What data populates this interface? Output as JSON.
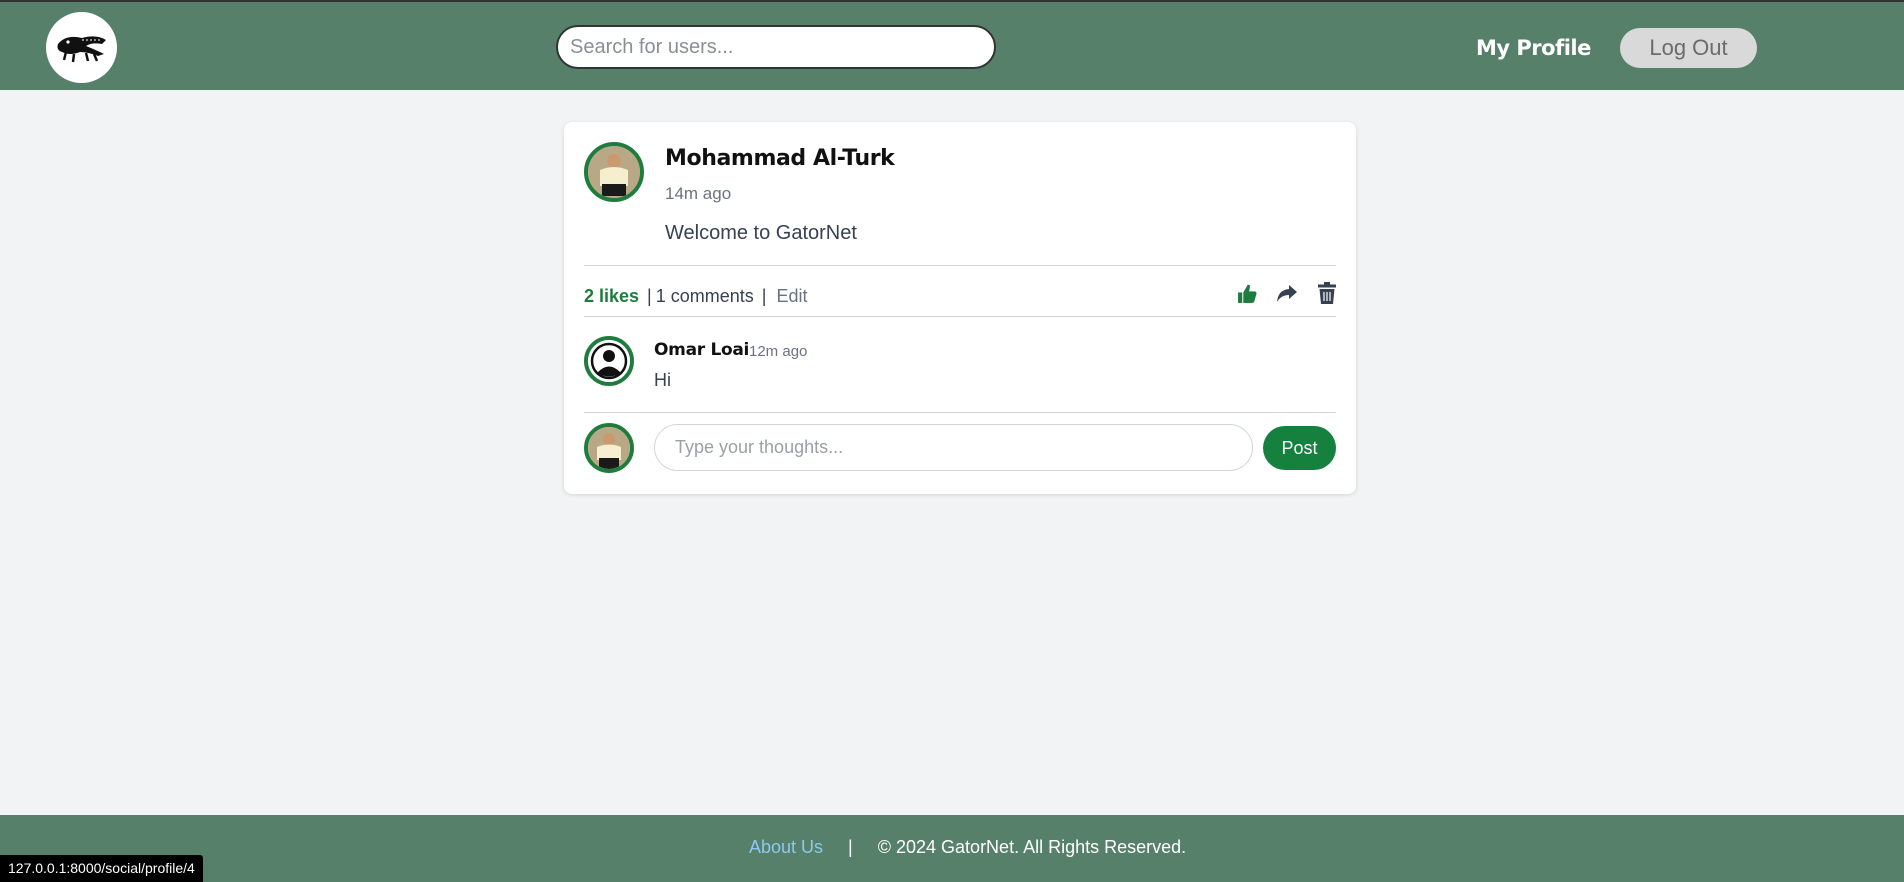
{
  "header": {
    "logo_icon": "alligator-logo-icon",
    "search_placeholder": "Search for users...",
    "my_profile_label": "My Profile",
    "logout_label": "Log Out"
  },
  "post": {
    "author": "Mohammad Al-Turk",
    "time": "14m ago",
    "content": "Welcome to GatorNet",
    "likes": "2 likes",
    "separator1": "|",
    "comments": "1 comments",
    "separator2": "|",
    "edit_label": "Edit",
    "actions": [
      "thumbs-up-icon",
      "share-icon",
      "trash-icon"
    ]
  },
  "comment": {
    "author": "Omar Loai",
    "time": "12m ago",
    "text": "Hi"
  },
  "new_comment": {
    "placeholder": "Type your thoughts...",
    "post_label": "Post"
  },
  "footer": {
    "about_label": "About Us",
    "divider": "|",
    "copyright": "© 2024 GatorNet. All Rights Reserved."
  },
  "status_url": "127.0.0.1:8000/social/profile/4",
  "colors": {
    "header_bg": "#568069",
    "accent_green": "#1e7d3e",
    "page_bg": "#f2f3f5",
    "about_link": "#8cc8f0"
  }
}
